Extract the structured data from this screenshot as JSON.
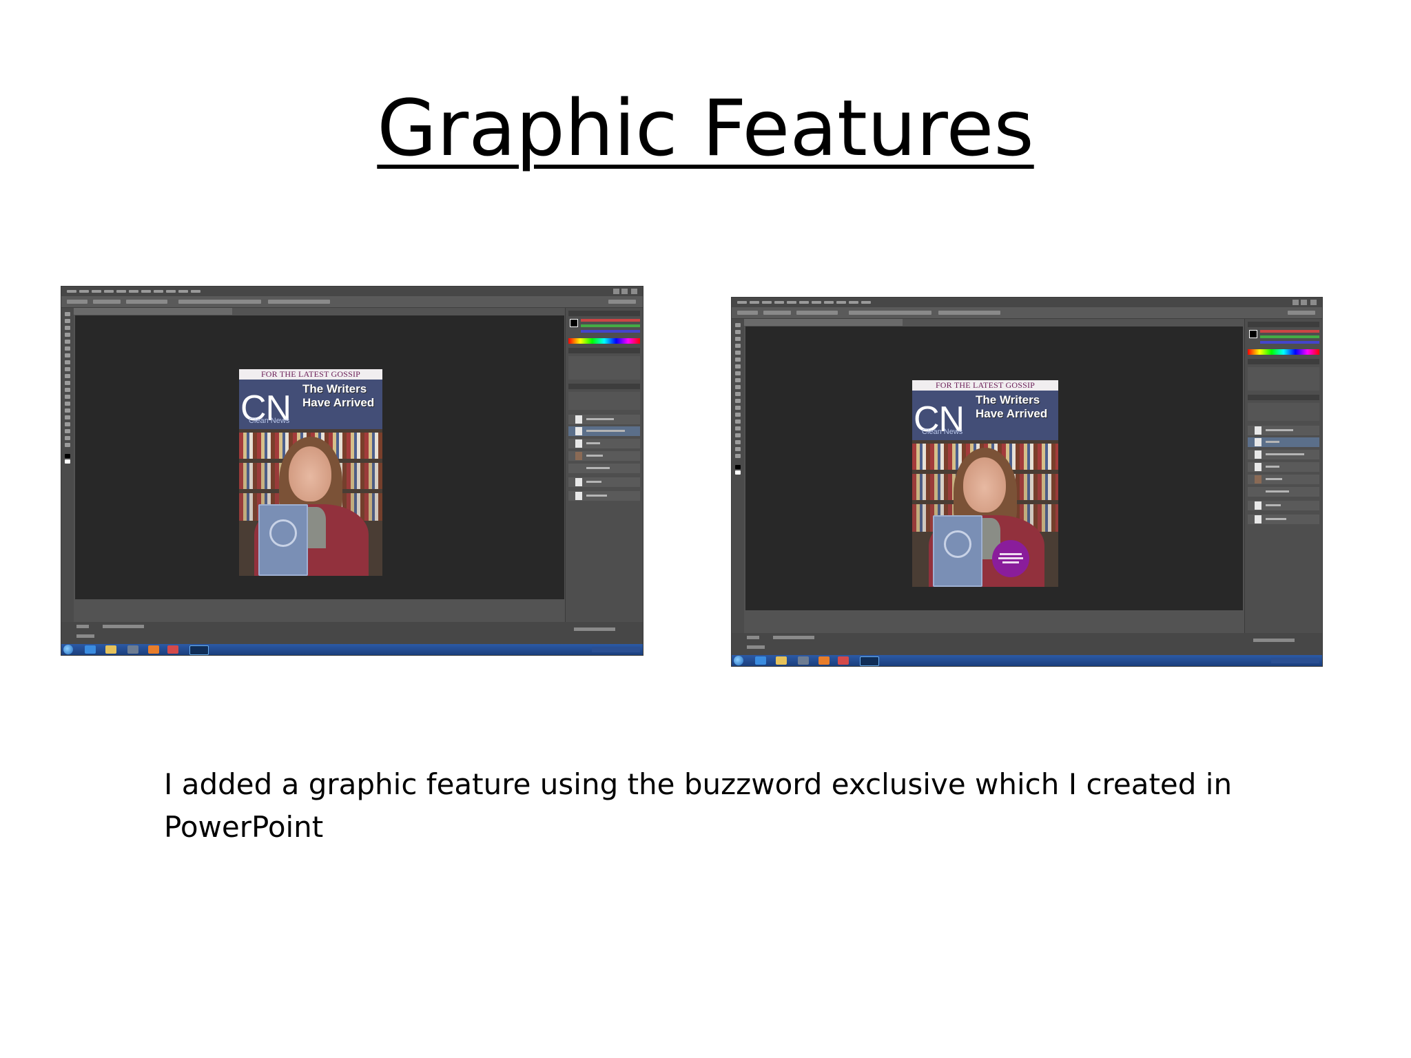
{
  "slide": {
    "title": "Graphic Features",
    "caption": "I added a graphic feature using the buzzword exclusive which I created in PowerPoint"
  },
  "cover": {
    "banner": "FOR THE LATEST GOSSIP",
    "logo": "CN",
    "logo_sub": "Clean News",
    "headline_line1": "The Writers",
    "headline_line2": "Have Arrived"
  },
  "colors": {
    "masthead": "#434e77",
    "banner_text": "#6b1e57",
    "badge": "#8a1d9b",
    "ps_canvas": "#282828",
    "taskbar": "#1b3f7d"
  },
  "icons": [
    "windows-start-icon",
    "internet-explorer-icon",
    "file-explorer-icon",
    "photoshop-icon"
  ]
}
